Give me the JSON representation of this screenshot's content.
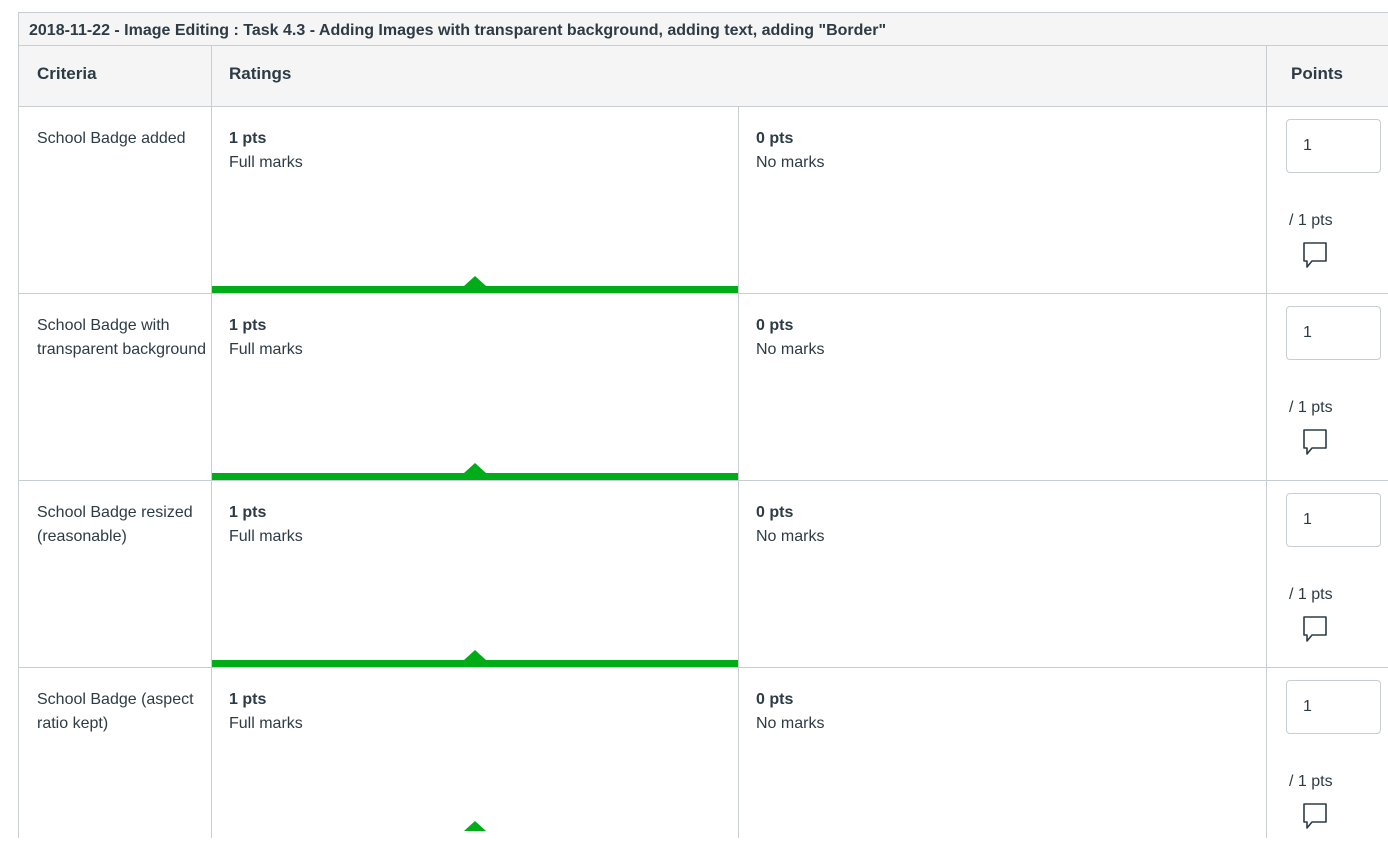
{
  "rubric": {
    "title": "2018-11-22 - Image Editing : Task 4.3 - Adding Images with transparent background, adding text, adding \"Border\"",
    "headers": {
      "criteria": "Criteria",
      "ratings": "Ratings",
      "points": "Points"
    },
    "criteria": [
      {
        "description": "School Badge added",
        "ratings": [
          {
            "points": "1 pts",
            "label": "Full marks",
            "selected": true
          },
          {
            "points": "0 pts",
            "label": "No marks",
            "selected": false
          }
        ],
        "score": "1",
        "out_of": "/ 1 pts"
      },
      {
        "description": "School Badge with transparent background",
        "ratings": [
          {
            "points": "1 pts",
            "label": "Full marks",
            "selected": true
          },
          {
            "points": "0 pts",
            "label": "No marks",
            "selected": false
          }
        ],
        "score": "1",
        "out_of": "/ 1 pts"
      },
      {
        "description": "School Badge resized (reasonable)",
        "ratings": [
          {
            "points": "1 pts",
            "label": "Full marks",
            "selected": true
          },
          {
            "points": "0 pts",
            "label": "No marks",
            "selected": false
          }
        ],
        "score": "1",
        "out_of": "/ 1 pts"
      },
      {
        "description": "School Badge (aspect ratio kept)",
        "ratings": [
          {
            "points": "1 pts",
            "label": "Full marks",
            "selected": true
          },
          {
            "points": "0 pts",
            "label": "No marks",
            "selected": false
          }
        ],
        "score": "1",
        "out_of": "/ 1 pts"
      }
    ],
    "selected_color": "#00ac18",
    "comment_icon": "comment-icon"
  }
}
